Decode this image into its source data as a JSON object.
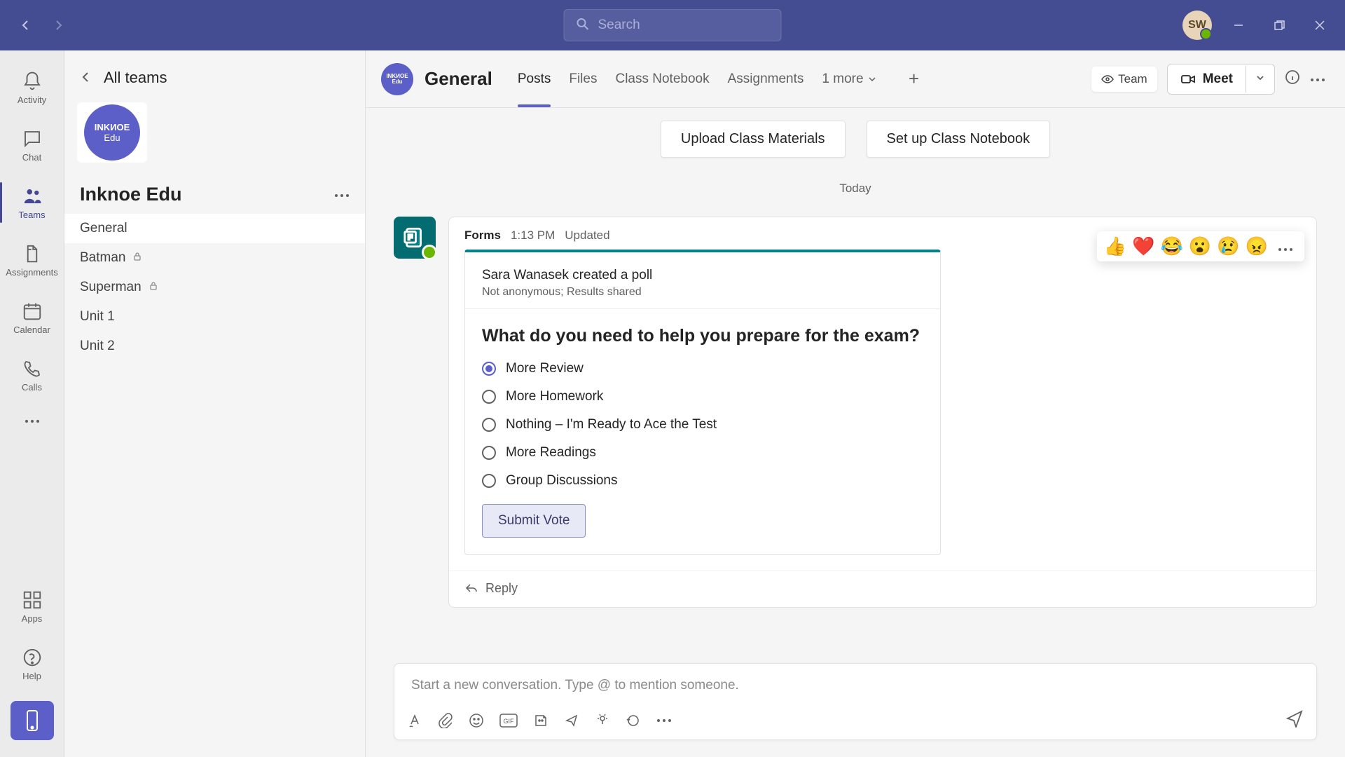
{
  "titlebar": {
    "search_placeholder": "Search",
    "avatar_initials": "SW"
  },
  "apprail": {
    "items": [
      {
        "icon": "bell",
        "label": "Activity",
        "active": false
      },
      {
        "icon": "chat",
        "label": "Chat",
        "active": false
      },
      {
        "icon": "teams",
        "label": "Teams",
        "active": true
      },
      {
        "icon": "assignments",
        "label": "Assignments",
        "active": false
      },
      {
        "icon": "calendar",
        "label": "Calendar",
        "active": false
      },
      {
        "icon": "calls",
        "label": "Calls",
        "active": false
      }
    ],
    "bottom": [
      {
        "icon": "apps",
        "label": "Apps"
      },
      {
        "icon": "help",
        "label": "Help"
      }
    ]
  },
  "channel_panel": {
    "back_label": "All teams",
    "team_logo_top": "INKИOE",
    "team_logo_bottom": "Edu",
    "team_name": "Inknoe Edu",
    "channels": [
      {
        "name": "General",
        "active": true,
        "private": false
      },
      {
        "name": "Batman",
        "active": false,
        "private": true
      },
      {
        "name": "Superman",
        "active": false,
        "private": true
      },
      {
        "name": "Unit 1",
        "active": false,
        "private": false
      },
      {
        "name": "Unit 2",
        "active": false,
        "private": false
      }
    ]
  },
  "main_header": {
    "channel_name": "General",
    "tabs": [
      {
        "label": "Posts",
        "active": true
      },
      {
        "label": "Files",
        "active": false
      },
      {
        "label": "Class Notebook",
        "active": false
      },
      {
        "label": "Assignments",
        "active": false
      }
    ],
    "more_tabs_label": "1 more",
    "visibility_label": "Team",
    "meet_label": "Meet"
  },
  "content": {
    "action_cards": [
      "Upload Class Materials",
      "Set up Class Notebook"
    ],
    "date_separator": "Today",
    "reactions": [
      "👍",
      "❤️",
      "😂",
      "😮",
      "😢",
      "😠"
    ],
    "message": {
      "app_name": "Forms",
      "time": "1:13 PM",
      "status": "Updated",
      "poll": {
        "creator_line": "Sara Wanasek created a poll",
        "meta_line": "Not anonymous; Results shared",
        "question": "What do you need to help you prepare for the exam?",
        "options": [
          {
            "label": "More Review",
            "selected": true
          },
          {
            "label": "More Homework",
            "selected": false
          },
          {
            "label": "Nothing – I'm Ready to Ace the Test",
            "selected": false
          },
          {
            "label": "More Readings",
            "selected": false
          },
          {
            "label": "Group Discussions",
            "selected": false
          }
        ],
        "submit_label": "Submit Vote"
      },
      "reply_label": "Reply"
    }
  },
  "compose": {
    "placeholder": "Start a new conversation. Type @ to mention someone."
  }
}
